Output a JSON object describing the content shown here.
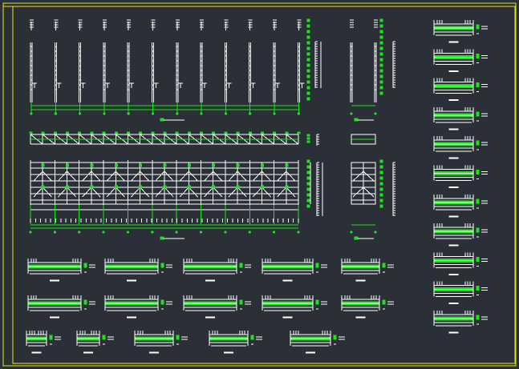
{
  "app": {
    "background": "#2b3038",
    "frame_color": "#e6e61a",
    "line_color": "#ffffff",
    "accent_color": "#19e619"
  },
  "drawing": {
    "elevation_columns": 12,
    "side_columns": 2,
    "truss_bays": 11,
    "section_details_right": 11,
    "beam_details_row1": 5,
    "beam_details_row2": 5,
    "beam_details_row3": 5
  }
}
